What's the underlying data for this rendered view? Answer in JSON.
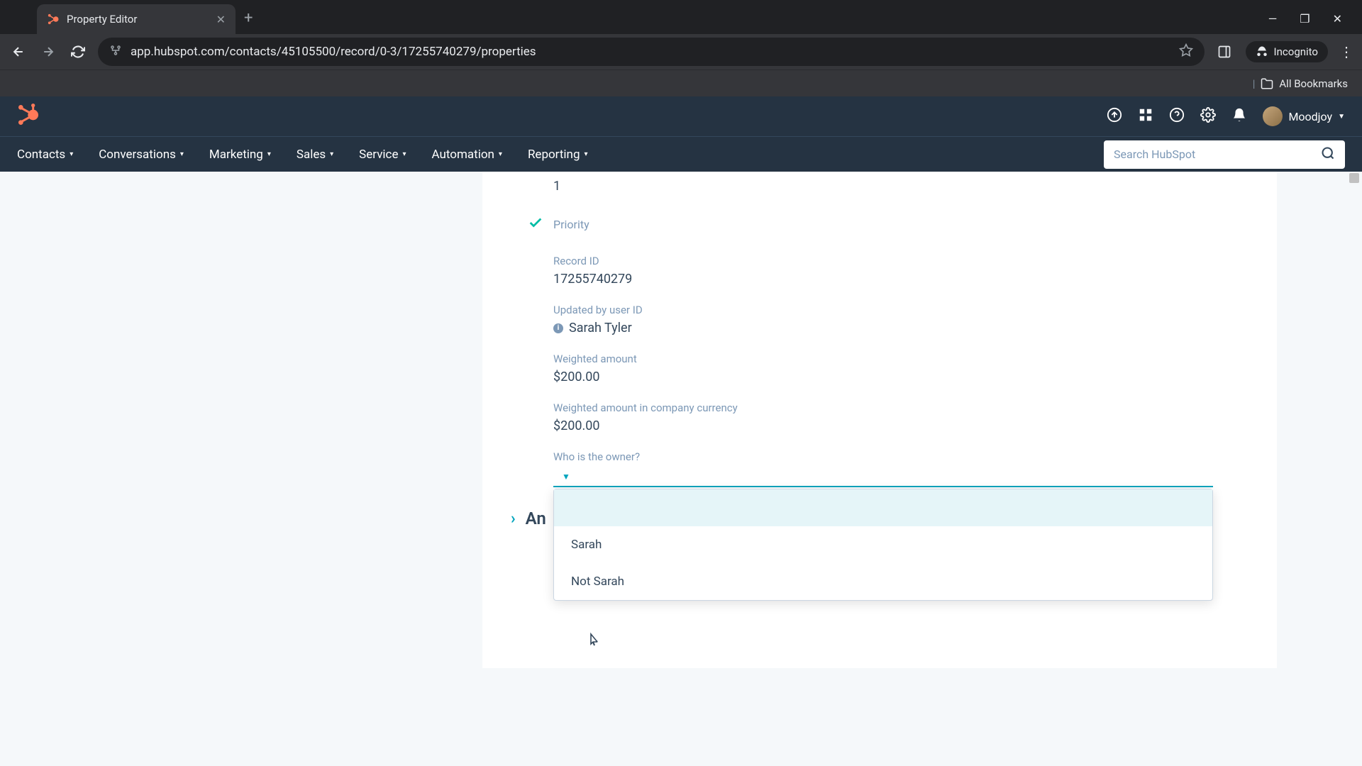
{
  "browser": {
    "tab_title": "Property Editor",
    "url": "app.hubspot.com/contacts/45105500/record/0-3/17255740279/properties",
    "incognito_label": "Incognito",
    "bookmarks_label": "All Bookmarks"
  },
  "header": {
    "account_name": "Moodjoy"
  },
  "nav": {
    "items": [
      "Contacts",
      "Conversations",
      "Marketing",
      "Sales",
      "Service",
      "Automation",
      "Reporting"
    ],
    "search_placeholder": "Search HubSpot"
  },
  "content": {
    "top_value": "1",
    "priority_label": "Priority",
    "fields": {
      "record_id": {
        "label": "Record ID",
        "value": "17255740279"
      },
      "updated_by": {
        "label": "Updated by user ID",
        "value": "Sarah Tyler"
      },
      "weighted_amount": {
        "label": "Weighted amount",
        "value": "$200.00"
      },
      "weighted_amount_cc": {
        "label": "Weighted amount in company currency",
        "value": "$200.00"
      },
      "owner": {
        "label": "Who is the owner?"
      }
    },
    "dropdown_options": [
      "",
      "Sarah",
      "Not Sarah"
    ],
    "section_truncated": "An"
  }
}
